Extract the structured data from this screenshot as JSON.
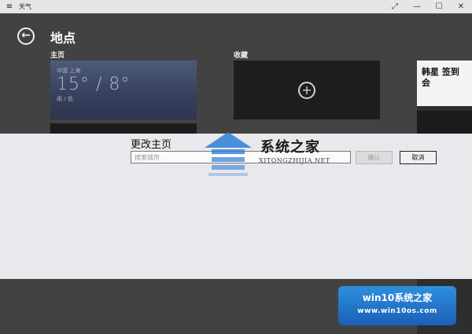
{
  "titlebar": {
    "menu_icon": "hamburger-icon",
    "app_title": "天气",
    "expand_glyph": "⤢",
    "min_glyph": "—",
    "max_glyph": "☐",
    "close_glyph": "✕"
  },
  "header": {
    "back_glyph": "←",
    "title": "地点"
  },
  "sections": {
    "home_label": "主页",
    "favorites_label": "收藏"
  },
  "home_tile": {
    "city": "中国 上海",
    "temperature": "15° / 8°",
    "condition": "雨 / 低"
  },
  "favorites_tile": {
    "add_glyph": "+"
  },
  "ad": {
    "text": "韩星 签到会"
  },
  "dialog": {
    "title": "更改主页",
    "input_value": "",
    "input_placeholder": "搜索城市",
    "confirm_label": "确认",
    "cancel_label": "取消"
  },
  "watermark": {
    "site_name": "系统之家",
    "site_url": "XITONGZHIJIA.NET",
    "badge_title": "win10系统之家",
    "badge_url": "www.win10os.com"
  },
  "colors": {
    "background": "#424242",
    "dialog": "#e8e9ec",
    "badge": "#1a5fb5"
  }
}
